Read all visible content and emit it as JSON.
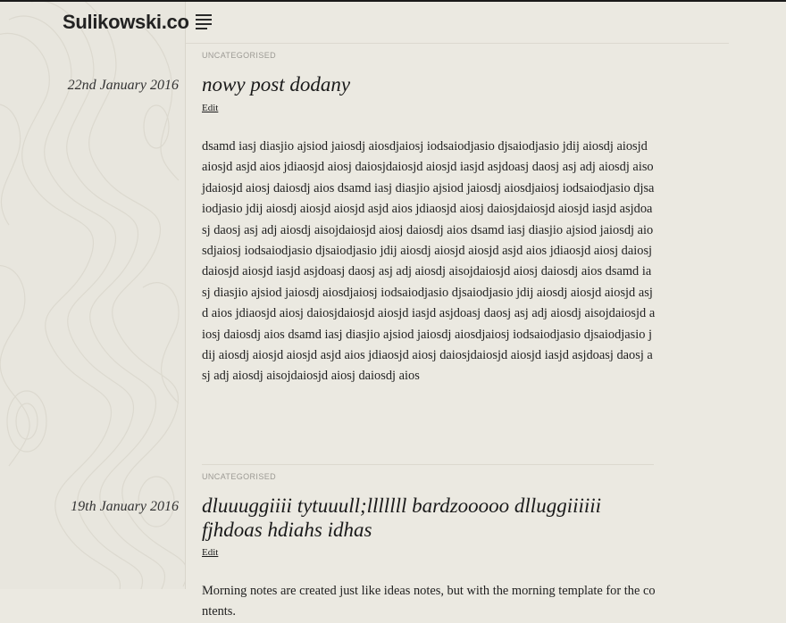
{
  "site": {
    "title": "Sulikowski.co",
    "menu_icon": "hamburger-menu-icon"
  },
  "posts": [
    {
      "category": "UNCATEGORISED",
      "date": "22nd January 2016",
      "title": "nowy post dodany",
      "edit_label": "Edit",
      "body": "dsamd iasj diasjio ajsiod jaiosdj aiosdjaiosj iodsaiodjasio djsaiodjasio jdij aiosdj aiosjd aiosjd asjd aios jdiaosjd aiosj daiosjdaiosjd aiosjd iasjd asjdoasj daosj asj adj aiosdj aisojdaiosjd aiosj daiosdj aios dsamd iasj diasjio ajsiod jaiosdj aiosdjaiosj iodsaiodjasio djsaiodjasio jdij aiosdj aiosjd aiosjd asjd aios jdiaosjd aiosj daiosjdaiosjd aiosjd iasjd asjdoasj daosj asj adj aiosdj aisojdaiosjd aiosj daiosdj aios dsamd iasj diasjio ajsiod jaiosdj aiosdjaiosj iodsaiodjasio djsaiodjasio jdij aiosdj aiosjd aiosjd asjd aios jdiaosjd aiosj daiosjdaiosjd aiosjd iasjd asjdoasj daosj asj adj aiosdj aisojdaiosjd aiosj daiosdj aios dsamd iasj diasjio ajsiod jaiosdj aiosdjaiosj iodsaiodjasio djsaiodjasio jdij aiosdj aiosjd aiosjd asjd aios jdiaosjd aiosj daiosjdaiosjd aiosjd iasjd asjdoasj daosj asj adj aiosdj aisojdaiosjd aiosj daiosdj aios dsamd iasj diasjio ajsiod jaiosdj aiosdjaiosj iodsaiodjasio djsaiodjasio jdij aiosdj aiosjd aiosjd asjd aios jdiaosjd aiosj daiosjdaiosjd aiosjd iasjd asjdoasj daosj asj adj aiosdj aisojdaiosjd aiosj daiosdj aios"
    },
    {
      "category": "UNCATEGORISED",
      "date": "19th January 2016",
      "title": "dluuuggiiii tytuuull;lllllll bardzooooo dlluggiiiiii fjhdoas hdiahs idhas",
      "edit_label": "Edit",
      "body": "Morning notes are created just like ideas notes, but with the morning template for the contents."
    }
  ],
  "colors": {
    "background": "#ebe9e1",
    "sidebar": "#e8e6de",
    "text": "#1e1e1e",
    "muted": "#9c9a94",
    "rule": "#dcd9cf"
  }
}
